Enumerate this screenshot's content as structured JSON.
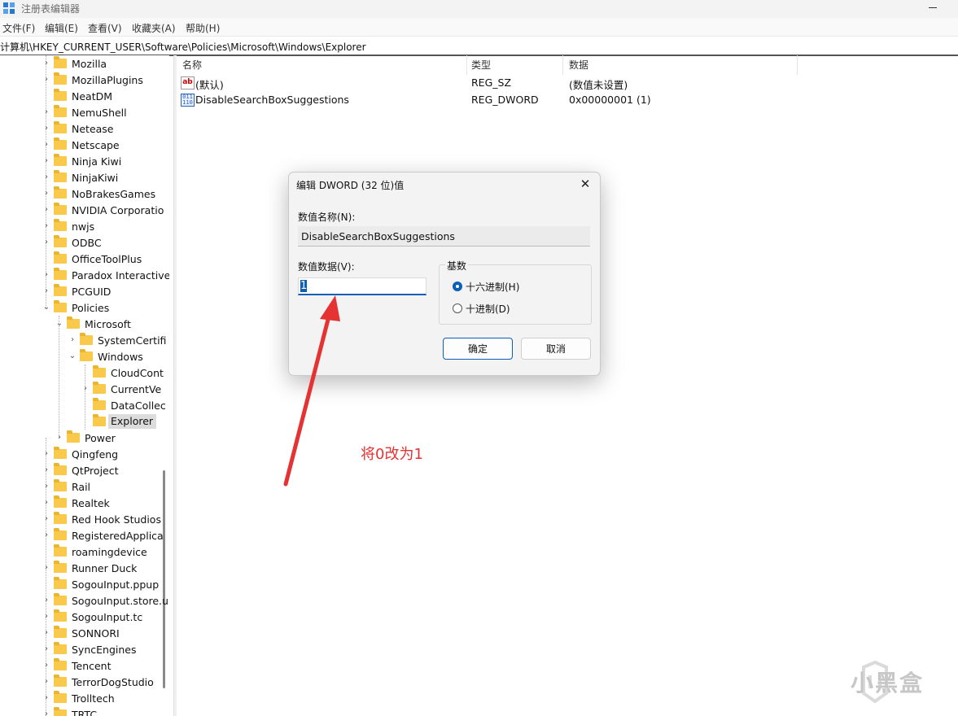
{
  "window": {
    "title": "注册表编辑器",
    "app_icon": "regedit-icon"
  },
  "menu": [
    "文件(F)",
    "编辑(E)",
    "查看(V)",
    "收藏夹(A)",
    "帮助(H)"
  ],
  "address": "计算机\\HKEY_CURRENT_USER\\Software\\Policies\\Microsoft\\Windows\\Explorer",
  "tree": [
    {
      "label": "Mozilla",
      "expander": "collapsed"
    },
    {
      "label": "MozillaPlugins",
      "expander": "collapsed"
    },
    {
      "label": "NeatDM",
      "expander": "none"
    },
    {
      "label": "NemuShell",
      "expander": "collapsed"
    },
    {
      "label": "Netease",
      "expander": "collapsed"
    },
    {
      "label": "Netscape",
      "expander": "collapsed"
    },
    {
      "label": "Ninja Kiwi",
      "expander": "collapsed"
    },
    {
      "label": "NinjaKiwi",
      "expander": "collapsed"
    },
    {
      "label": "NoBrakesGames",
      "expander": "collapsed"
    },
    {
      "label": "NVIDIA Corporatio",
      "expander": "collapsed"
    },
    {
      "label": "nwjs",
      "expander": "collapsed"
    },
    {
      "label": "ODBC",
      "expander": "collapsed"
    },
    {
      "label": "OfficeToolPlus",
      "expander": "none"
    },
    {
      "label": "Paradox Interactive",
      "expander": "collapsed"
    },
    {
      "label": "PCGUID",
      "expander": "collapsed"
    },
    {
      "label": "Policies",
      "expander": "expanded"
    },
    {
      "label": "Microsoft",
      "expander": "expanded"
    },
    {
      "label": "SystemCertifi",
      "expander": "collapsed"
    },
    {
      "label": "Windows",
      "expander": "expanded"
    },
    {
      "label": "CloudCont",
      "expander": "none"
    },
    {
      "label": "CurrentVe",
      "expander": "collapsed"
    },
    {
      "label": "DataCollec",
      "expander": "none"
    },
    {
      "label": "Explorer",
      "expander": "none",
      "selected": true
    },
    {
      "label": "Power",
      "expander": "collapsed"
    },
    {
      "label": "Qingfeng",
      "expander": "collapsed"
    },
    {
      "label": "QtProject",
      "expander": "collapsed"
    },
    {
      "label": "Rail",
      "expander": "collapsed"
    },
    {
      "label": "Realtek",
      "expander": "collapsed"
    },
    {
      "label": "Red Hook Studios",
      "expander": "collapsed"
    },
    {
      "label": "RegisteredApplica",
      "expander": "collapsed"
    },
    {
      "label": "roamingdevice",
      "expander": "none"
    },
    {
      "label": "Runner Duck",
      "expander": "collapsed"
    },
    {
      "label": "SogouInput.ppup",
      "expander": "none"
    },
    {
      "label": "SogouInput.store.u",
      "expander": "collapsed"
    },
    {
      "label": "SogouInput.tc",
      "expander": "collapsed"
    },
    {
      "label": "SONNORI",
      "expander": "collapsed"
    },
    {
      "label": "SyncEngines",
      "expander": "collapsed"
    },
    {
      "label": "Tencent",
      "expander": "collapsed"
    },
    {
      "label": "TerrorDogStudio",
      "expander": "collapsed"
    },
    {
      "label": "Trolltech",
      "expander": "collapsed"
    },
    {
      "label": "TRTC",
      "expander": "collapsed"
    }
  ],
  "columns": {
    "name": "名称",
    "type": "类型",
    "data": "数据"
  },
  "values": [
    {
      "name": "(默认)",
      "type": "REG_SZ",
      "data": "(数值未设置)",
      "icon": "string-value-icon"
    },
    {
      "name": "DisableSearchBoxSuggestions",
      "type": "REG_DWORD",
      "data": "0x00000001 (1)",
      "icon": "dword-value-icon"
    }
  ],
  "dialog": {
    "title": "编辑 DWORD (32 位)值",
    "name_label": "数值名称(N):",
    "name_value": "DisableSearchBoxSuggestions",
    "data_label": "数值数据(V):",
    "data_value": "1",
    "base_label": "基数",
    "hex_label": "十六进制(H)",
    "dec_label": "十进制(D)",
    "selected_base": "hex",
    "ok_label": "确定",
    "cancel_label": "取消"
  },
  "annotation": {
    "text": "将0改为1",
    "color": "#e53333"
  },
  "watermark": {
    "text": "小黑盒"
  },
  "colors": {
    "accent": "#0b5fb8",
    "folder": "#f8c94b",
    "arrow": "#e53333"
  }
}
